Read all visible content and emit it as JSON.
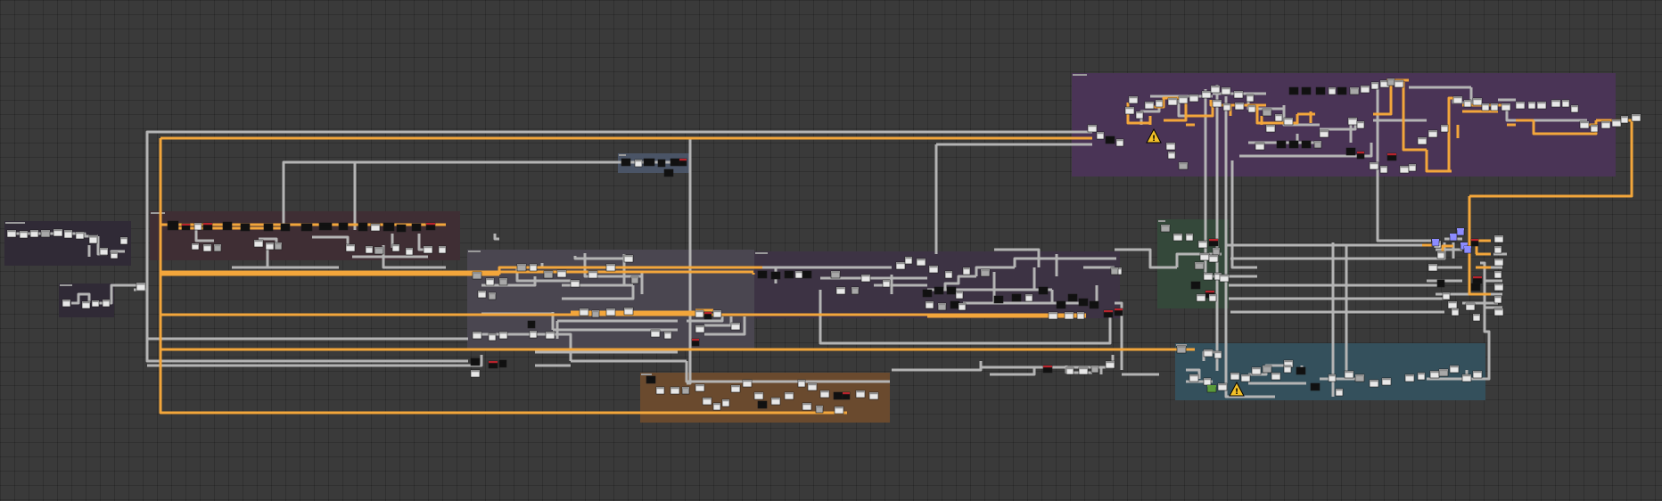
{
  "editor": {
    "background": "#3a3a3a",
    "grid_color": "#2e2e2e",
    "colors": {
      "wire_default": "#b4b4b4",
      "wire_highlight": "#f3a63b",
      "node_body": "#e8e8e8",
      "node_dark": "#111111",
      "node_header_red": "#b7232c",
      "node_header_gray": "#8d8d8d",
      "selected_blue": "#8c8cff",
      "warning_yellow": "#f2c028",
      "pin_green": "#5a9a3a"
    },
    "groups": [
      {
        "id": "g1",
        "color": "#302a36",
        "label": ""
      },
      {
        "id": "g2",
        "color": "#302a36",
        "label": ""
      },
      {
        "id": "g3",
        "color": "#3f2e34",
        "label": ""
      },
      {
        "id": "g4",
        "color": "#4a5466",
        "label": ""
      },
      {
        "id": "g5",
        "color": "#4a4650",
        "label": ""
      },
      {
        "id": "g6",
        "color": "#3d3344",
        "label": ""
      },
      {
        "id": "g7",
        "color": "#6a4a2e",
        "label": ""
      },
      {
        "id": "g8",
        "color": "#4a3456",
        "label": ""
      },
      {
        "id": "g9",
        "color": "#34483a",
        "label": ""
      },
      {
        "id": "g10",
        "color": "#34505c",
        "label": ""
      }
    ],
    "warnings": [
      {
        "id": "w1",
        "icon": "warning-icon",
        "glyph": "!"
      },
      {
        "id": "w2",
        "icon": "warning-icon",
        "glyph": "!"
      }
    ]
  }
}
